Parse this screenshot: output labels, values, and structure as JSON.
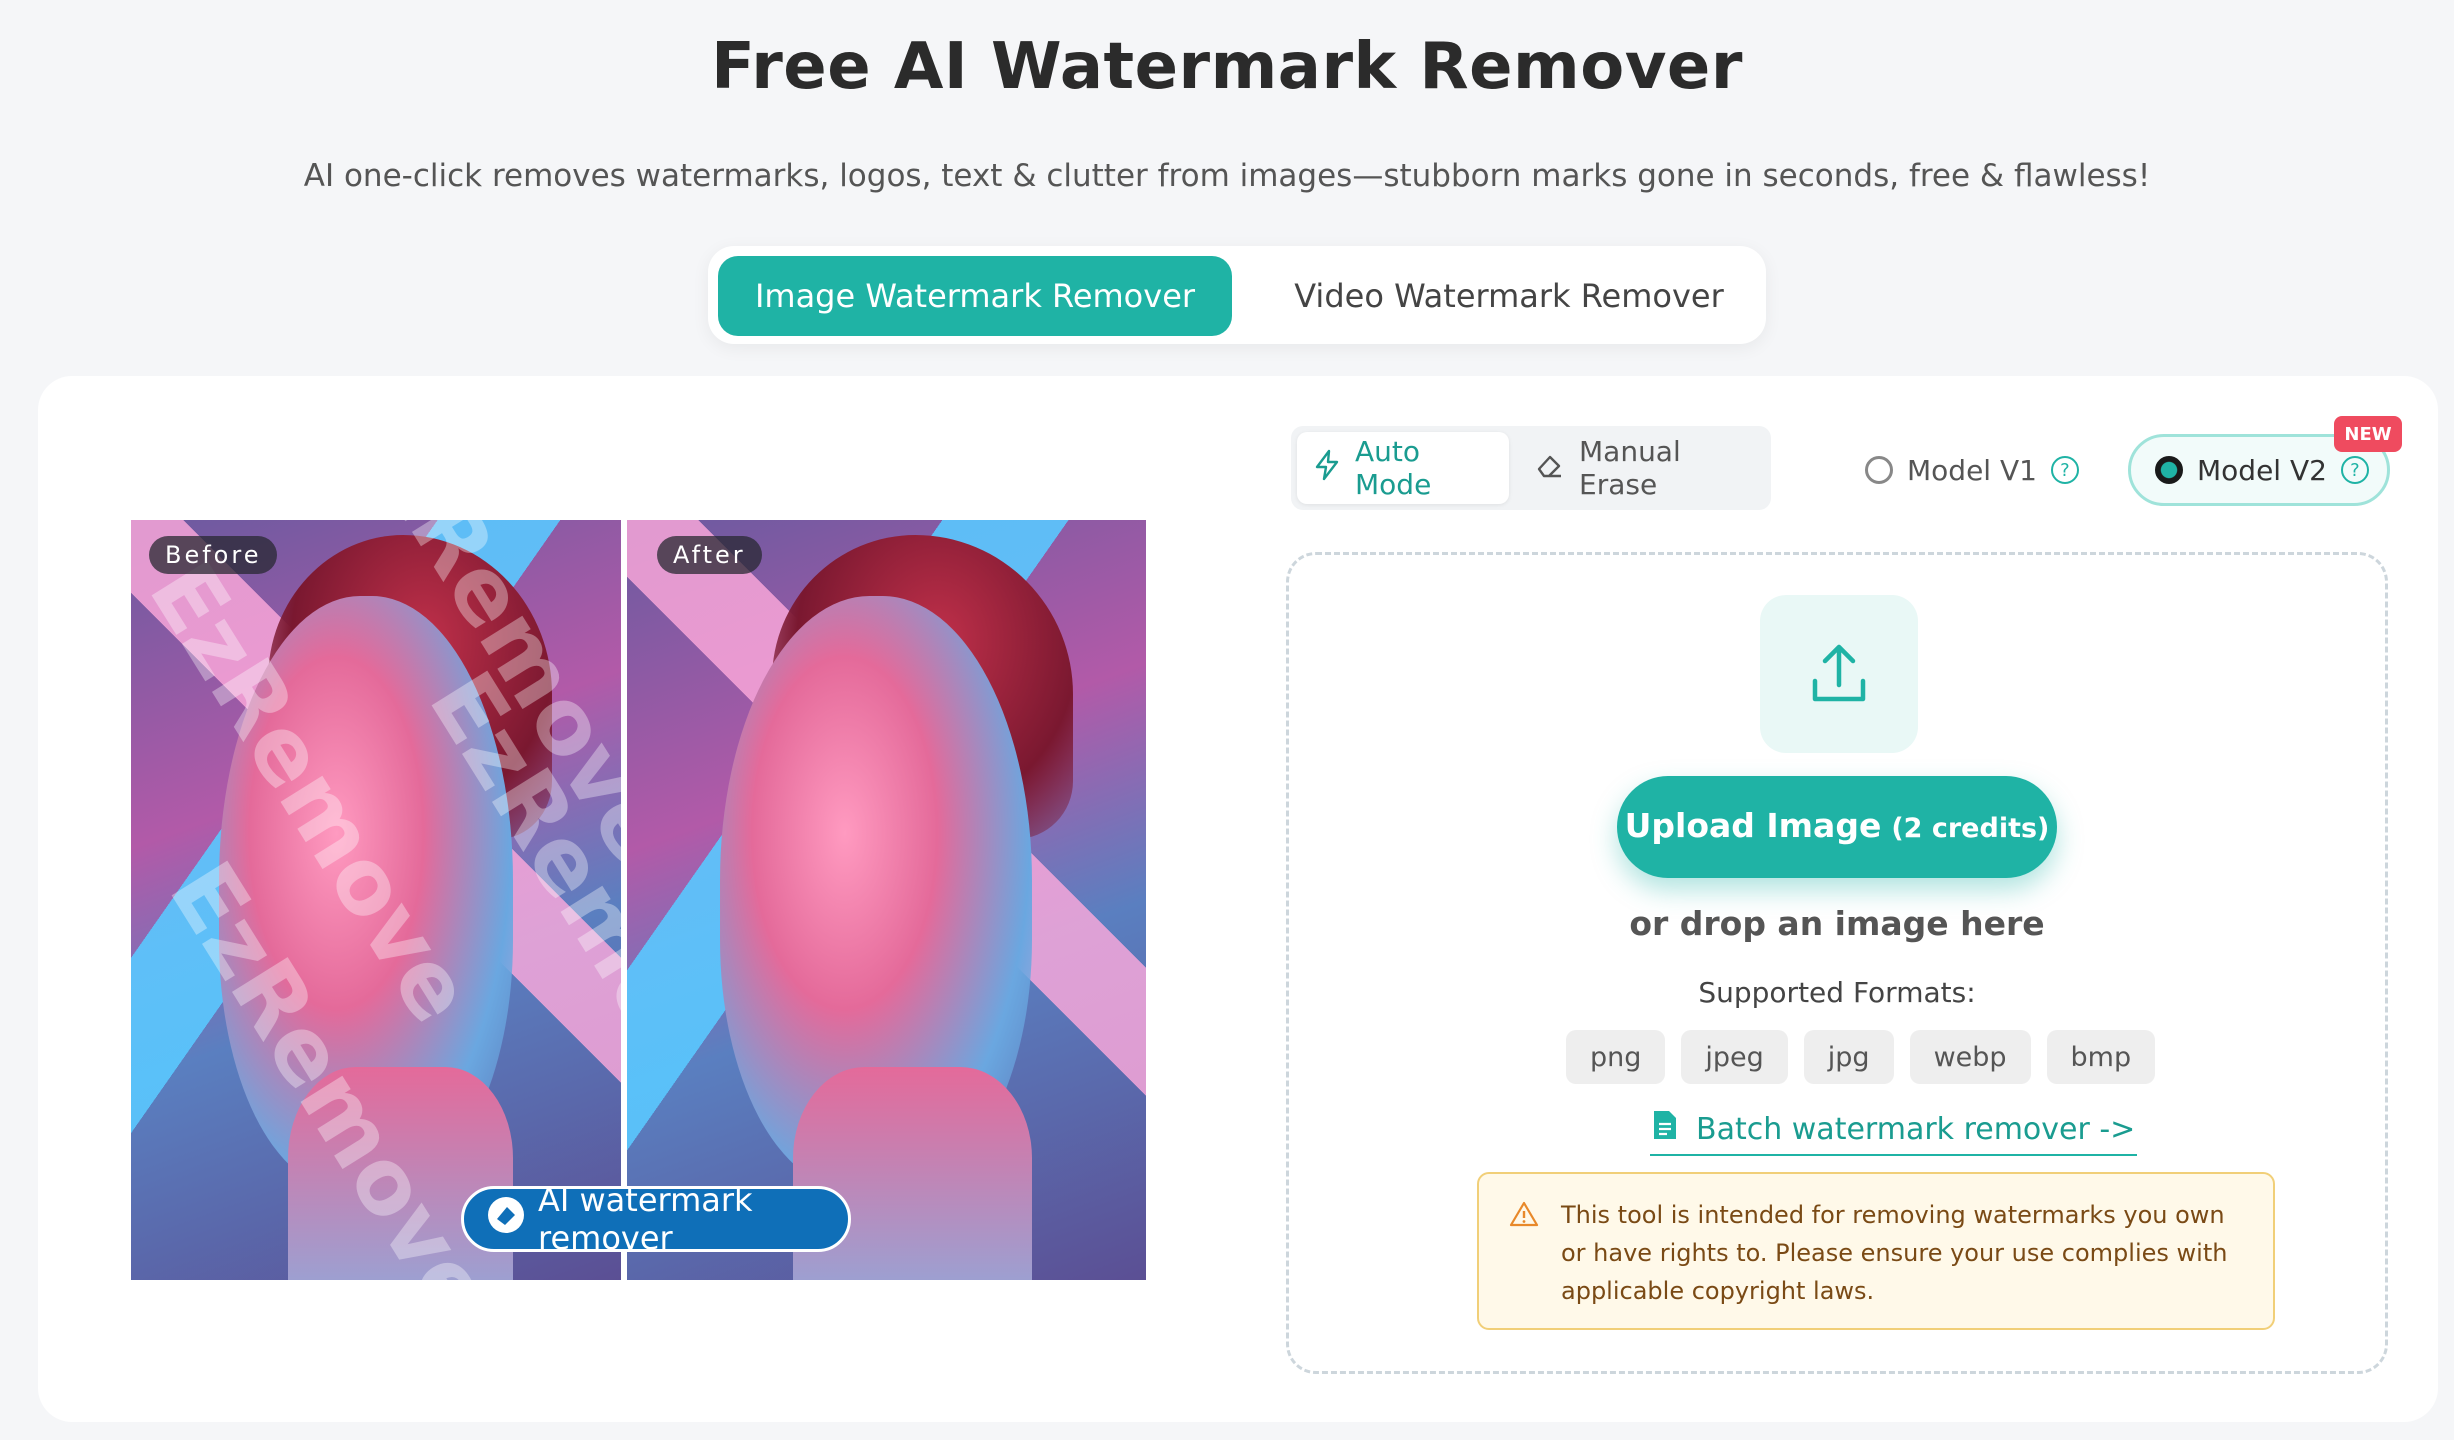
{
  "header": {
    "title": "Free AI Watermark Remover",
    "subtitle": "AI one-click removes watermarks, logos, text & clutter from images—stubborn marks gone in seconds, free & flawless!"
  },
  "tabs": [
    {
      "label": "Image Watermark Remover",
      "active": true
    },
    {
      "label": "Video Watermark Remover",
      "active": false
    }
  ],
  "preview": {
    "before_label": "Before",
    "after_label": "After",
    "watermark_text": "EzRemove",
    "badge_text": "AI watermark remover"
  },
  "modes": {
    "auto": "Auto Mode",
    "manual": "Manual Erase",
    "selected": "auto"
  },
  "models": {
    "v1": "Model V1",
    "v2": "Model V2",
    "selected": "v2",
    "new_badge": "NEW"
  },
  "upload": {
    "button_main": "Upload Image",
    "button_credits": "(2 credits)",
    "drop_text": "or drop an image here",
    "formats_title": "Supported Formats:",
    "formats": [
      "png",
      "jpeg",
      "jpg",
      "webp",
      "bmp"
    ],
    "batch_link": "Batch watermark remover ->"
  },
  "notice": {
    "text": "This tool is intended for removing watermarks you own or have rights to. Please ensure your use complies with applicable copyright laws."
  },
  "colors": {
    "accent": "#1fb3a5",
    "new_badge": "#ef4b5f",
    "notice_bg": "#fff9e9"
  }
}
